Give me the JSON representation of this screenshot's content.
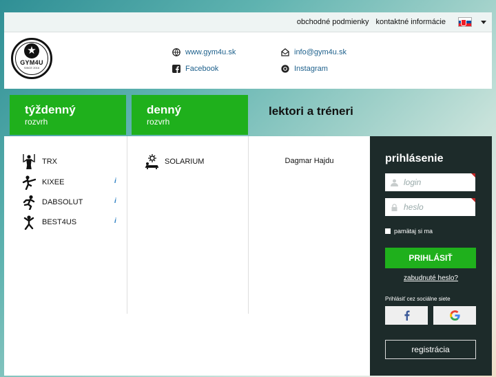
{
  "topbar": {
    "links": [
      "obchodné podmienky",
      "kontaktné informácie"
    ]
  },
  "brand": {
    "logo_text": "GYM4U",
    "logo_sub": "SINCE 2016"
  },
  "contact": {
    "website": "www.gym4u.sk",
    "facebook": "Facebook",
    "email": "info@gym4u.sk",
    "instagram": "Instagram"
  },
  "tabs": [
    {
      "line1": "týždenný",
      "line2": "rozvrh"
    },
    {
      "line1": "denný",
      "line2": "rozvrh"
    },
    {
      "line1": "lektori a tréneri"
    }
  ],
  "weekly": [
    {
      "label": "TRX",
      "info": false,
      "icon": "trx-person-icon"
    },
    {
      "label": "KIXEE",
      "info": true,
      "icon": "kick-person-icon"
    },
    {
      "label": "DABSOLUT",
      "info": true,
      "icon": "running-person-icon"
    },
    {
      "label": "BEST4US",
      "info": true,
      "icon": "jumping-person-icon"
    }
  ],
  "info_glyph": "i",
  "daily": [
    {
      "label": "SOLARIUM",
      "icon": "solarium-icon"
    }
  ],
  "trainers": [
    "Dagmar Hajdu"
  ],
  "login": {
    "title": "prihlásenie",
    "login_placeholder": "login",
    "password_placeholder": "heslo",
    "remember": "pamätaj si ma",
    "submit": "PRIHLÁSIŤ",
    "forgot": "zabudnuté heslo?",
    "social_label": "Prihlásiť cez sociálne siete",
    "register": "registrácia"
  },
  "colors": {
    "accent_green": "#1fb01c",
    "link_blue": "#1c5f8b",
    "login_bg": "#1d2b2a"
  }
}
